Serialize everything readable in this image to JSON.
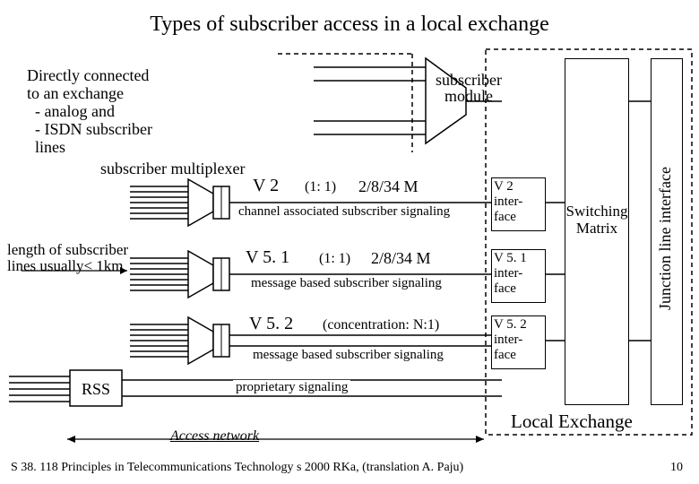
{
  "title": "Types of subscriber access in a local exchange",
  "direct": {
    "l1": "Directly connected",
    "l2": "to an exchange",
    "l3": "  - analog and",
    "l4": "  - ISDN subscriber",
    "l5": "  lines"
  },
  "sub_mux": "subscriber multiplexer",
  "len_note": {
    "l1": "length of subscriber",
    "l2": "lines usually< 1km"
  },
  "rss": "RSS",
  "sub_module": {
    "l1": "subscriber",
    "l2": "module"
  },
  "v2": {
    "name": "V 2",
    "ratio": "(1: 1)",
    "rate": "2/8/34 M",
    "sig": "channel associated subscriber signaling"
  },
  "v51": {
    "name": "V 5. 1",
    "ratio": "(1: 1)",
    "rate": "2/8/34 M",
    "sig": "message based subscriber signaling"
  },
  "v52": {
    "name": "V 5. 2",
    "ratio": "(concentration:  N:1)",
    "sig": "message based subscriber signaling"
  },
  "prop_sig": "proprietary signaling",
  "iface_v2": {
    "l1": "V 2",
    "l2": "inter-",
    "l3": "face"
  },
  "iface_v51": {
    "l1": "V 5. 1",
    "l2": "inter-",
    "l3": "face"
  },
  "iface_v52": {
    "l1": "V 5. 2",
    "l2": "inter-",
    "l3": "face"
  },
  "switching": {
    "l1": "Switching",
    "l2": "Matrix"
  },
  "jli": "Junction line interface",
  "local_ex": "Local Exchange",
  "access_net": "Access network",
  "footer": "S 38. 118  Principles in Telecommunications Technology  s 2000  RKa,  (translation A. Paju)",
  "page": "10"
}
